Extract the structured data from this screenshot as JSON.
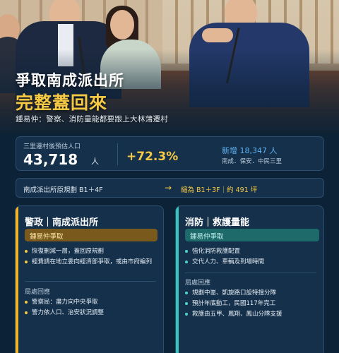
{
  "hero": {
    "headline_line1": "爭取南成派出所",
    "headline_line2": "完整蓋回來",
    "caption": "鍾易仲：警察、消防量能都要跟上大林蒲遷村"
  },
  "stats": {
    "label": "三里遷村後預估人口",
    "population": "43,718",
    "unit": "人",
    "growth": "+72.3%",
    "added": "新增 18,347 人",
    "areas": "南成．保安．中民三里"
  },
  "plan": {
    "original": "南成派出所原規劃 B1＋4F",
    "arrow": "→",
    "revised": "縮為 B1＋3F｜約 491 坪"
  },
  "police": {
    "title": "警政｜南成派出所",
    "tag": "鍾易仲爭取",
    "requests": [
      "恢復刪減一層，蓋回原規劃",
      "經費請在地立委向經濟部爭取，或由市府編列"
    ],
    "response_heading": "局處回應",
    "responses": [
      "警察局：盡力向中央爭取",
      "警力依人口、治安狀況調整"
    ],
    "accent_color": "#f0b429"
  },
  "fire": {
    "title": "消防｜救護量能",
    "tag": "鍾易仲爭取",
    "requests": [
      "強化消防救護配置",
      "交代人力、車輛及到場時間"
    ],
    "response_heading": "局處回應",
    "responses": [
      "規劃中崙、凱旋路口設特搜分隊",
      "預計年底動工，民國117年完工",
      "救護由五甲、鳳翔、鳳山分隊支援"
    ],
    "accent_color": "#36c6c0"
  }
}
